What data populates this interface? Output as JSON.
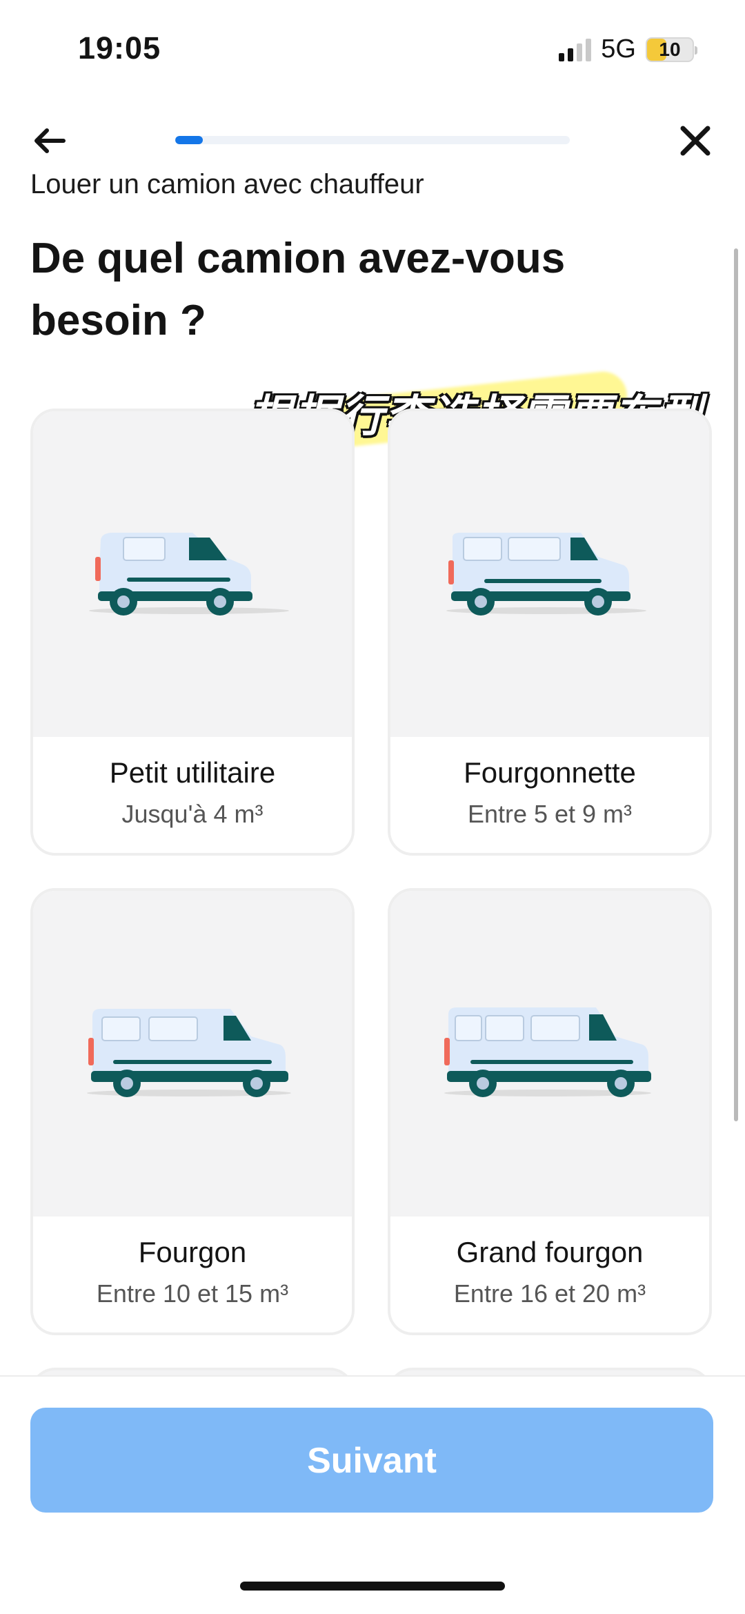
{
  "status_bar": {
    "time": "19:05",
    "network": "5G",
    "battery": "10"
  },
  "header": {
    "progress_fraction": 0.07,
    "subtitle": "Louer un camion avec chauffeur",
    "title": "De quel camion avez-vous besoin ?"
  },
  "caption": "根据行李选择需要车型",
  "vehicles": [
    {
      "name": "Petit utilitaire",
      "size": "Jusqu'à 4 m³",
      "icon": "small-van-icon"
    },
    {
      "name": "Fourgonnette",
      "size": "Entre 5 et 9 m³",
      "icon": "fourgonnette-icon"
    },
    {
      "name": "Fourgon",
      "size": "Entre 10 et 15 m³",
      "icon": "fourgon-icon"
    },
    {
      "name": "Grand fourgon",
      "size": "Entre 16 et 20 m³",
      "icon": "grand-fourgon-icon"
    }
  ],
  "footer": {
    "next_label": "Suivant"
  },
  "colors": {
    "accent": "#1476e8",
    "button_disabled": "#7fb9f7",
    "van_body": "#dce9fa",
    "van_dark": "#0e5a5a"
  },
  "icons": [
    "back-arrow-icon",
    "close-icon",
    "signal-icon",
    "battery-icon"
  ]
}
